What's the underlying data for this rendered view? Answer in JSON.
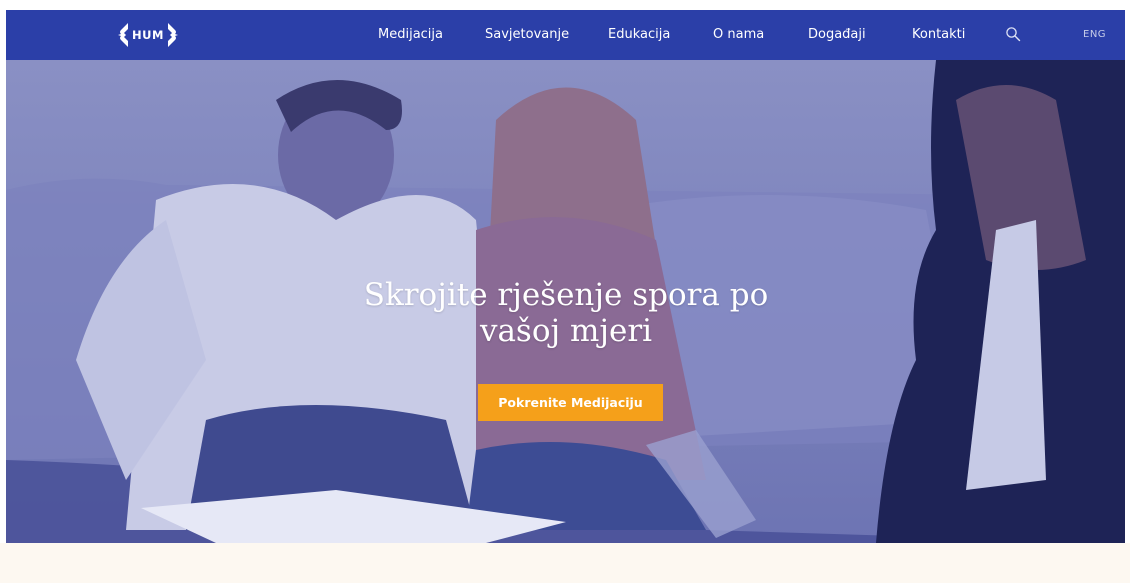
{
  "brand": {
    "logo_text": "HUM"
  },
  "nav": {
    "items": [
      {
        "label": "Medijacija"
      },
      {
        "label": "Savjetovanje"
      },
      {
        "label": "Edukacija"
      },
      {
        "label": "O nama"
      },
      {
        "label": "Događaji"
      },
      {
        "label": "Kontakti"
      }
    ],
    "search_icon": "search-icon",
    "language": "ENG"
  },
  "hero": {
    "title_line1": "Skrojite rješenje spora po",
    "title_line2": "vašoj mjeri",
    "cta_label": "Pokrenite Medijaciju"
  },
  "colors": {
    "navbar": "#2b3fa8",
    "cta": "#f5a01a",
    "hero_overlay": "#5a63ab",
    "footer_band": "#fdf8f1"
  }
}
